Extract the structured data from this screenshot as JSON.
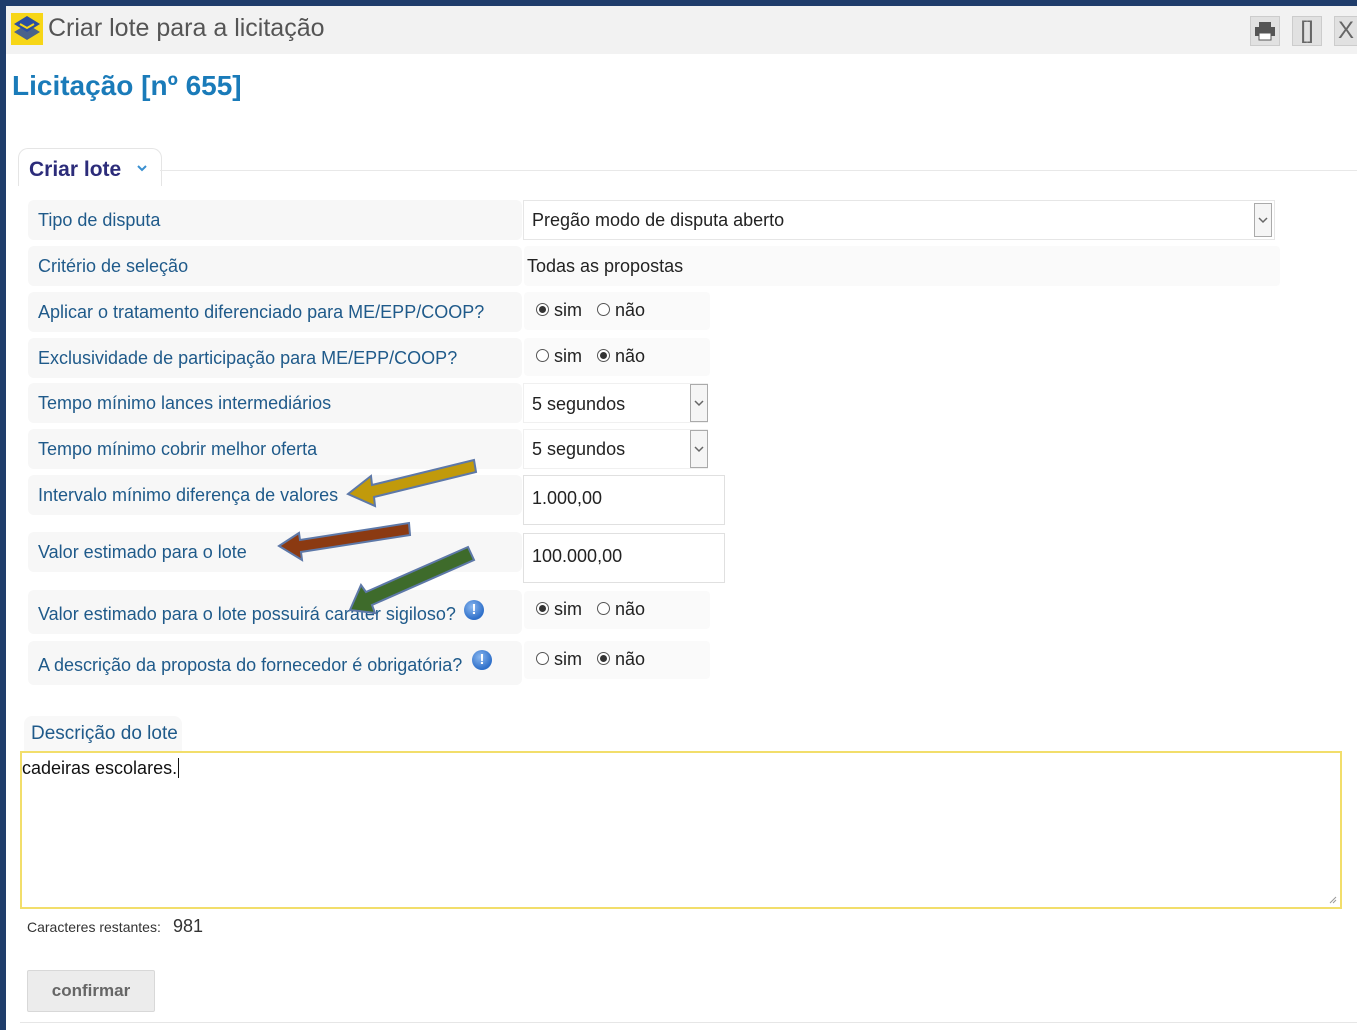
{
  "window": {
    "title": "Criar lote para a licitação",
    "print_icon": "printer-icon",
    "restore_label": "[]",
    "close_label": "X"
  },
  "page": {
    "title": "Licitação [nº 655]"
  },
  "section": {
    "label": "Criar lote",
    "chevron_icon": "chevron-down-icon"
  },
  "form": {
    "tipo_disputa": {
      "label": "Tipo de disputa",
      "value": "Pregão modo de disputa aberto"
    },
    "criterio_selecao": {
      "label": "Critério de seleção",
      "value": "Todas as propostas"
    },
    "tratamento_diferenciado": {
      "label": "Aplicar o tratamento diferenciado para ME/EPP/COOP?",
      "option_yes": "sim",
      "option_no": "não",
      "selected": "sim"
    },
    "exclusividade": {
      "label": "Exclusividade de participação para ME/EPP/COOP?",
      "option_yes": "sim",
      "option_no": "não",
      "selected": "não"
    },
    "tempo_lances": {
      "label": "Tempo mínimo lances intermediários",
      "value": "5 segundos"
    },
    "tempo_cobrir": {
      "label": "Tempo mínimo cobrir melhor oferta",
      "value": "5 segundos"
    },
    "intervalo_minimo": {
      "label": "Intervalo mínimo diferença de valores",
      "value": "1.000,00"
    },
    "valor_estimado": {
      "label": "Valor estimado para o lote",
      "value": "100.000,00"
    },
    "carater_sigiloso": {
      "label": "Valor estimado para o lote possuirá caráter sigiloso?",
      "option_yes": "sim",
      "option_no": "não",
      "selected": "sim",
      "info_icon": "info-icon"
    },
    "descricao_obrigatoria": {
      "label": "A descrição da proposta do fornecedor é obrigatória?",
      "option_yes": "sim",
      "option_no": "não",
      "selected": "não",
      "info_icon": "info-icon"
    }
  },
  "descricao": {
    "label": "Descrição do lote",
    "value": "cadeiras escolares.",
    "remaining_label": "Caracteres restantes:",
    "remaining_count": "981"
  },
  "actions": {
    "confirm_label": "confirmar"
  },
  "annotations": {
    "arrow_colors": [
      "#c19a0b",
      "#8b3a12",
      "#3e6b2b"
    ]
  },
  "colors": {
    "frame": "#1f3d6b",
    "title_blue": "#1a7bb9",
    "label_blue": "#1f5a8a",
    "textarea_focus": "#f2de6b"
  }
}
